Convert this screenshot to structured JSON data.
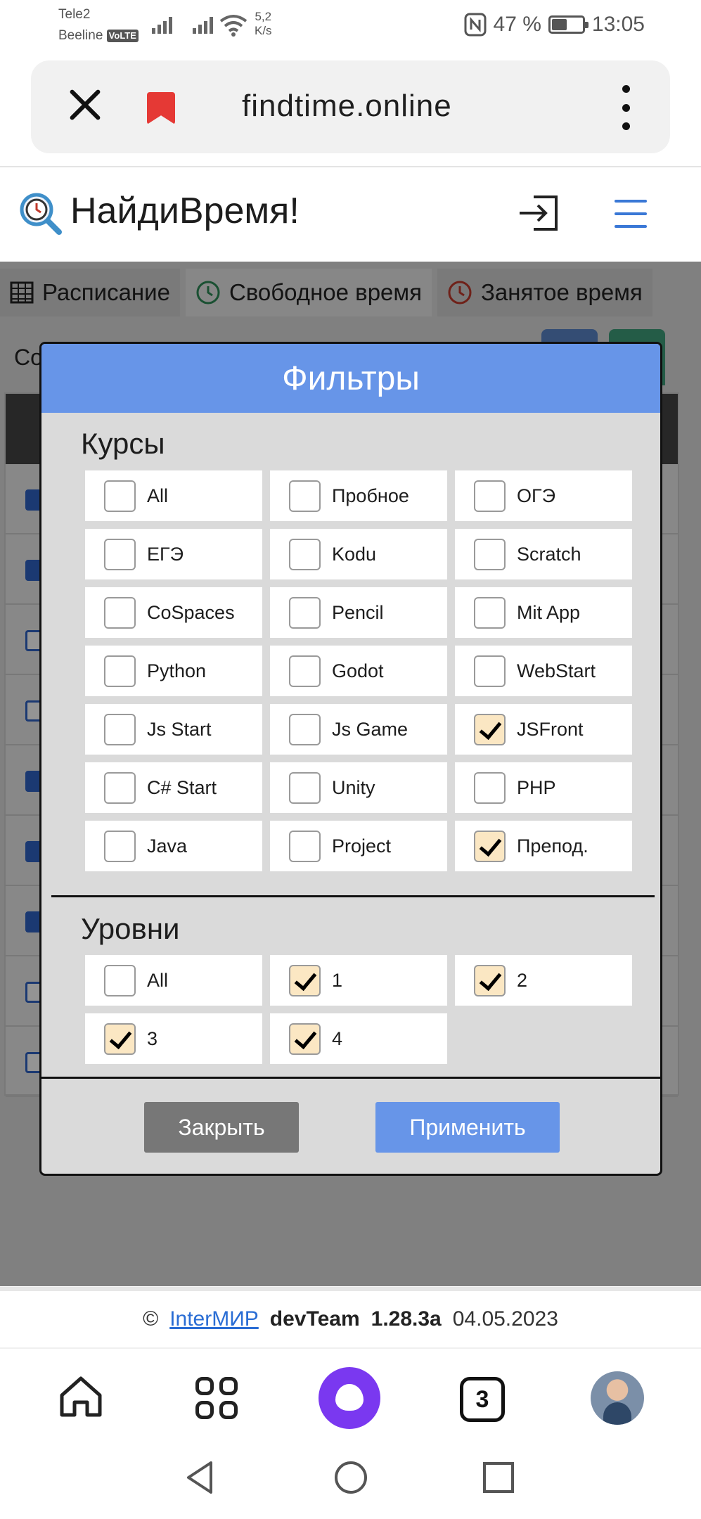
{
  "status_bar": {
    "carrier1": "Tele2",
    "carrier2": "Beeline",
    "volte": "VoLTE",
    "speed_value": "5,2",
    "speed_unit": "K/s",
    "battery": "47 %",
    "battery_level": 0.47,
    "time": "13:05"
  },
  "browser": {
    "url": "findtime.online"
  },
  "site": {
    "title": "НайдиВремя!"
  },
  "tabs": [
    {
      "label": "Расписание"
    },
    {
      "label": "Свободное время"
    },
    {
      "label": "Занятое время"
    }
  ],
  "background_text": "Co",
  "modal": {
    "title": "Фильтры",
    "courses_title": "Курсы",
    "courses": [
      {
        "label": "All",
        "checked": false
      },
      {
        "label": "Пробное",
        "checked": false
      },
      {
        "label": "ОГЭ",
        "checked": false
      },
      {
        "label": "ЕГЭ",
        "checked": false
      },
      {
        "label": "Kodu",
        "checked": false
      },
      {
        "label": "Scratch",
        "checked": false
      },
      {
        "label": "CoSpaces",
        "checked": false
      },
      {
        "label": "Pencil",
        "checked": false
      },
      {
        "label": "Mit App",
        "checked": false
      },
      {
        "label": "Python",
        "checked": false
      },
      {
        "label": "Godot",
        "checked": false
      },
      {
        "label": "WebStart",
        "checked": false
      },
      {
        "label": "Js Start",
        "checked": false
      },
      {
        "label": "Js Game",
        "checked": false
      },
      {
        "label": "JSFront",
        "checked": true
      },
      {
        "label": "C# Start",
        "checked": false
      },
      {
        "label": "Unity",
        "checked": false
      },
      {
        "label": "PHP",
        "checked": false
      },
      {
        "label": "Java",
        "checked": false
      },
      {
        "label": "Project",
        "checked": false
      },
      {
        "label": "Препод.",
        "checked": true
      }
    ],
    "levels_title": "Уровни",
    "levels": [
      {
        "label": "All",
        "checked": false
      },
      {
        "label": "1",
        "checked": true
      },
      {
        "label": "2",
        "checked": true
      },
      {
        "label": "3",
        "checked": true
      },
      {
        "label": "4",
        "checked": true
      }
    ],
    "close_label": "Закрыть",
    "apply_label": "Применить"
  },
  "footer": {
    "copyright": "©",
    "link": "InterМИР",
    "team": "devTeam",
    "version": "1.28.3a",
    "date": "04.05.2023"
  },
  "bottom_nav": {
    "tabs_count": "3"
  },
  "colors": {
    "accent_blue": "#6795e8",
    "checked_bg": "#fbe7c3",
    "alice_purple": "#7a38f0"
  }
}
